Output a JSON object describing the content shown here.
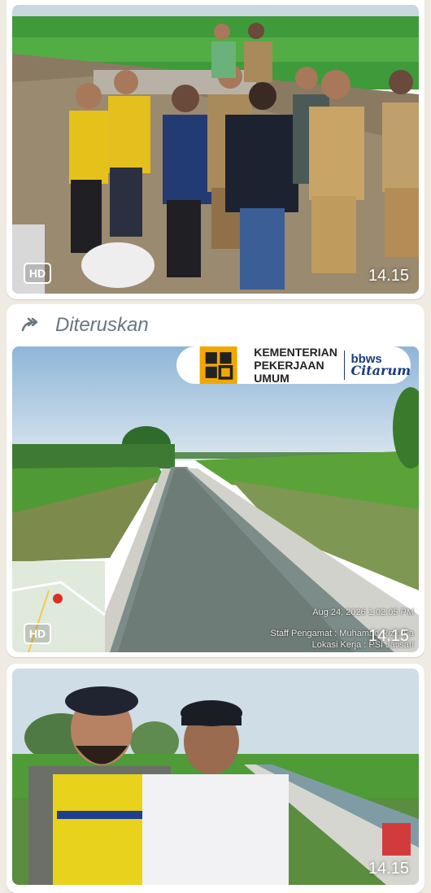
{
  "messages": [
    {
      "hd_badge": "HD",
      "time": "14.15"
    },
    {
      "forwarded_label": "Diteruskan",
      "brand": {
        "ministry": "KEMENTERIAN PEKERJAAN UMUM",
        "org_top": "bbws",
        "org_bottom": "Citarum"
      },
      "stamp": {
        "datetime": "Aug 24, 2026 1:02:05 PM",
        "staff": "Staff Pengamat : Muhamad Rizki Fa",
        "location": "Lokasi Kerja : PSI Jatisari"
      },
      "hd_badge": "HD",
      "time": "14.15"
    },
    {
      "time": "14.15"
    }
  ]
}
